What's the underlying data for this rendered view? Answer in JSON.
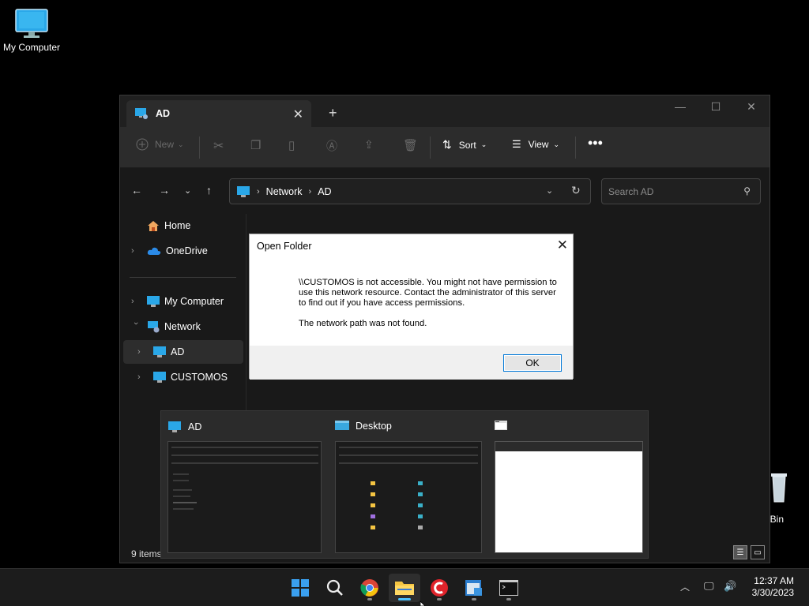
{
  "desktop": {
    "icons": [
      {
        "label": "My Computer",
        "icon": "monitor-icon"
      },
      {
        "label": "cle Bin",
        "icon": "recycle-bin-icon"
      }
    ]
  },
  "explorer": {
    "tab_title": "AD",
    "toolbar": {
      "new_label": "New",
      "sort_label": "Sort",
      "view_label": "View"
    },
    "address": {
      "crumbs": [
        "Network",
        "AD"
      ]
    },
    "search": {
      "placeholder": "Search AD"
    },
    "nav": {
      "home": "Home",
      "onedrive": "OneDrive",
      "my_computer": "My Computer",
      "network": "Network",
      "ad": "AD",
      "customos": "CUSTOMOS"
    },
    "status": "9 items"
  },
  "dialog": {
    "title": "Open Folder",
    "message": "\\\\CUSTOMOS is not accessible. You might not have permission to use this network resource. Contact the administrator of this server to find out if you have access permissions.",
    "detail": "The network path was not found.",
    "ok_label": "OK"
  },
  "thumbnails": [
    {
      "title": "AD",
      "icon": "network-pc-icon"
    },
    {
      "title": "Desktop",
      "icon": "desktop-folder-icon"
    },
    {
      "title": "",
      "icon": "console-window-icon"
    }
  ],
  "taskbar": {
    "apps": [
      "start",
      "search",
      "chrome",
      "file-explorer",
      "ccleaner",
      "network-config",
      "terminal"
    ],
    "clock": {
      "time": "12:37 AM",
      "date": "3/30/2023"
    }
  },
  "colors": {
    "accent": "#4cc2ff",
    "monitor_blue": "#2aa7e8",
    "folder_yellow": "#f5c542"
  }
}
